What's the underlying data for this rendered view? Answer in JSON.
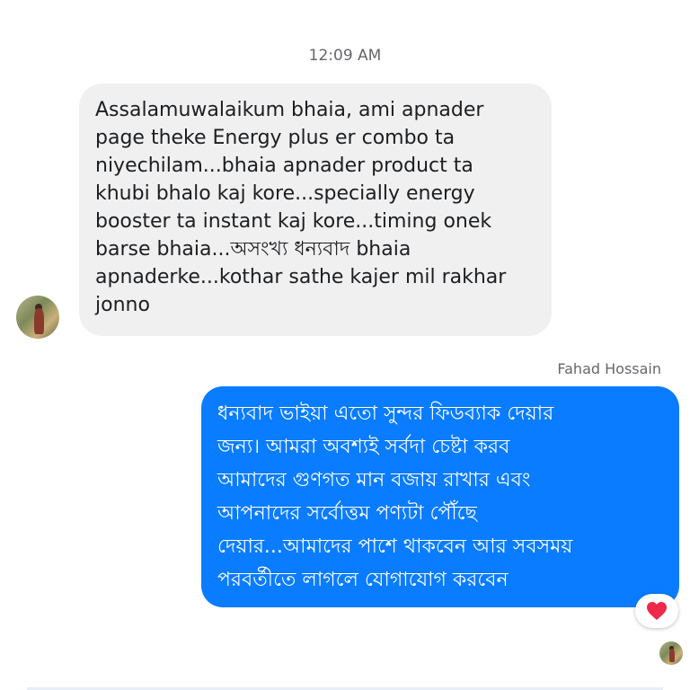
{
  "timestamp": "12:09 AM",
  "incoming_message": {
    "lines": [
      "Assalamuwalaikum bhaia, ami apnader",
      "page theke Energy plus er combo ta",
      "niyechilam...bhaia apnader product ta",
      "khubi bhalo kaj kore...specially energy",
      "booster ta instant kaj kore...timing onek",
      "barse bhaia...অসংখ্য ধন্যবাদ bhaia",
      "apnaderke...kothar sathe kajer mil rakhar",
      "jonno"
    ],
    "bubble_color": "#f0f0f0"
  },
  "outgoing_message": {
    "sender_name": "Fahad Hossain",
    "lines": [
      "ধন্যবাদ ভাইয়া এতো সুন্দর ফিডব্যাক দেয়ার",
      "জন্য। আমরা অবশ্যই সর্বদা চেষ্টা করব",
      "আমাদের গুণগত মান বজায় রাখার এবং",
      "আপনাদের সর্বোত্তম পণ্যটা পৌঁছে",
      "দেয়ার...আমাদের পাশে থাকবেন আর সবসময়",
      "পরবর্তীতে লাগলে যোগাযোগ করবেন"
    ],
    "bubble_color": "#0a7cff",
    "reaction": "heart-icon",
    "reaction_color": "#f02849"
  }
}
